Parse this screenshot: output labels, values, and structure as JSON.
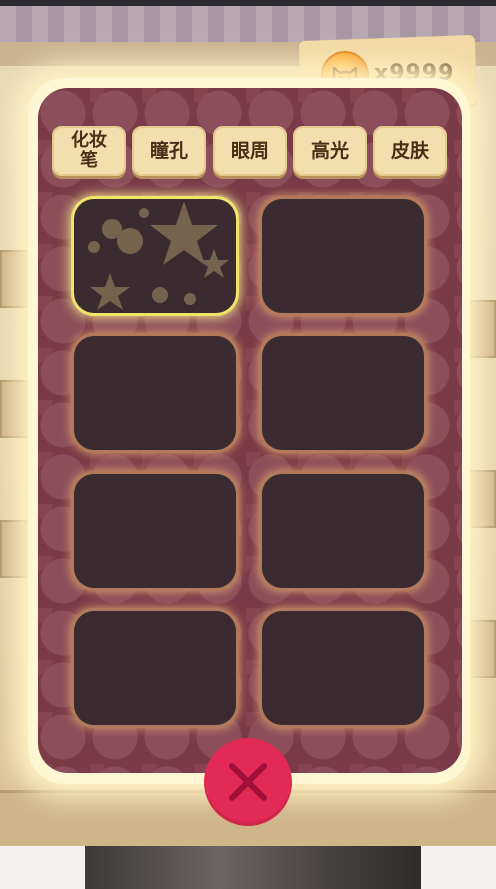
{
  "currency": {
    "icon": "cat-coin-icon",
    "count": "x9999"
  },
  "tabs": [
    {
      "label": "化妆\n笔",
      "name": "tab-makeup-pen"
    },
    {
      "label": "瞳孔",
      "name": "tab-pupil"
    },
    {
      "label": "眼周",
      "name": "tab-eye-area"
    },
    {
      "label": "高光",
      "name": "tab-highlight"
    },
    {
      "label": "皮肤",
      "name": "tab-skin"
    }
  ],
  "items": [
    {
      "state": "selected",
      "icon": "star-pattern-icon"
    },
    {
      "state": "empty"
    },
    {
      "state": "empty"
    },
    {
      "state": "empty"
    },
    {
      "state": "empty"
    },
    {
      "state": "empty"
    },
    {
      "state": "empty"
    },
    {
      "state": "empty"
    }
  ],
  "close_button": {
    "icon": "close-x-icon"
  },
  "colors": {
    "panel": "#7a3a48",
    "slot": "#3a2b30",
    "selected_border": "#f0e36a",
    "close": "#e22a55",
    "coin": "#f5a623"
  }
}
